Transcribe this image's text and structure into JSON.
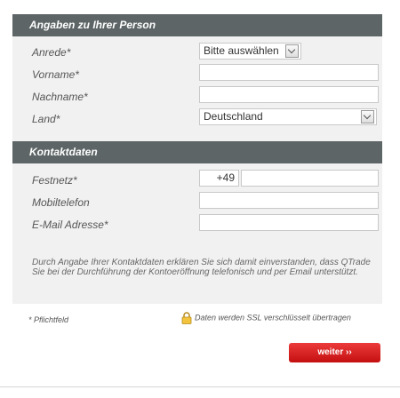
{
  "personal": {
    "title": "Angaben zu Ihrer Person",
    "salutation_label": "Anrede*",
    "salutation_value": "Bitte auswählen",
    "firstname_label": "Vorname*",
    "firstname_value": "",
    "lastname_label": "Nachname*",
    "lastname_value": "",
    "country_label": "Land*",
    "country_value": "Deutschland"
  },
  "contact": {
    "title": "Kontaktdaten",
    "landline_label": "Festnetz*",
    "landline_prefix": "+49",
    "landline_value": "",
    "mobile_label": "Mobiltelefon",
    "mobile_value": "",
    "email_label": "E-Mail Adresse*",
    "email_value": ""
  },
  "consent_note": "Durch Angabe Ihrer Kontaktdaten erklären Sie sich damit einverstanden, dass QTrade Sie bei der Durchführung der Kontoeröffnung telefonisch und per Email unterstützt.",
  "footer": {
    "required_hint": "* Pflichtfeld",
    "ssl_text": "Daten werden SSL verschlüsselt übertragen",
    "next_button": "weiter ››"
  },
  "colors": {
    "header_bg": "#5d6566",
    "panel_bg": "#f1f1f1",
    "button_red": "#d81e1e"
  },
  "icons": {
    "ssl": "lock-icon"
  }
}
